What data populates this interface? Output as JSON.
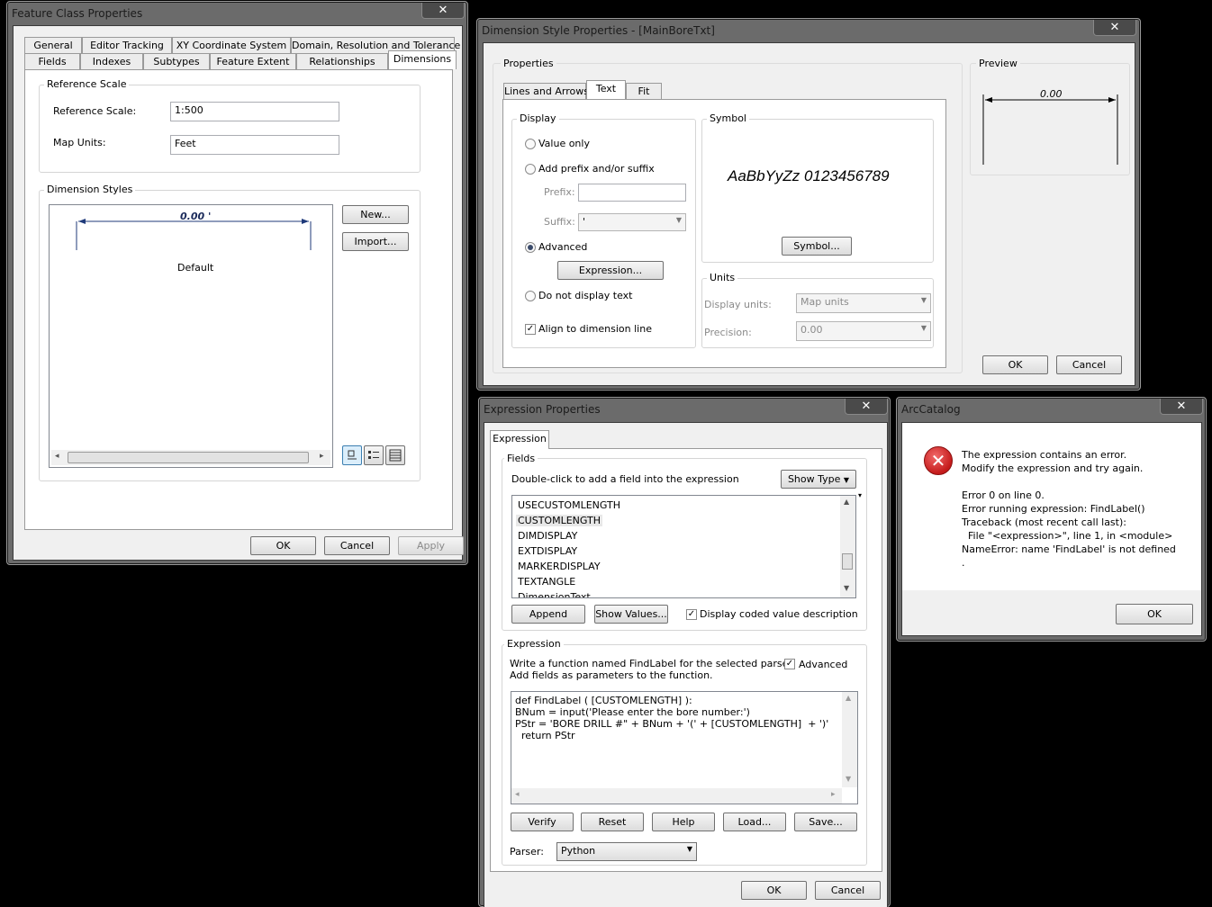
{
  "fc": {
    "title": "Feature Class Properties",
    "tabs_row1": [
      "General",
      "Editor Tracking",
      "XY Coordinate System",
      "Domain, Resolution and Tolerance"
    ],
    "tabs_row2": [
      "Fields",
      "Indexes",
      "Subtypes",
      "Feature Extent",
      "Relationships",
      "Dimensions"
    ],
    "reference_scale_group": "Reference Scale",
    "reference_scale_label": "Reference Scale:",
    "reference_scale_value": "1:500",
    "map_units_label": "Map Units:",
    "map_units_value": "Feet",
    "dimension_styles_group": "Dimension Styles",
    "preview_value": "0.00 '",
    "style_name": "Default",
    "new_button": "New...",
    "import_button": "Import...",
    "ok": "OK",
    "cancel": "Cancel",
    "apply": "Apply"
  },
  "ds": {
    "title": "Dimension Style Properties - [MainBoreTxt]",
    "properties_group": "Properties",
    "preview_group": "Preview",
    "preview_value": "0.00",
    "tabs": [
      "Lines and Arrows",
      "Text",
      "Fit"
    ],
    "display_group": "Display",
    "value_only": "Value only",
    "add_prefix": "Add prefix and/or suffix",
    "prefix_label": "Prefix:",
    "suffix_label": "Suffix:",
    "suffix_value": "'",
    "advanced": "Advanced",
    "expression_button": "Expression...",
    "do_not_display": "Do not display text",
    "align": "Align to dimension line",
    "symbol_group": "Symbol",
    "symbol_sample": "AaBbYyZz 0123456789",
    "symbol_button": "Symbol...",
    "units_group": "Units",
    "display_units_label": "Display units:",
    "display_units_value": "Map units",
    "precision_label": "Precision:",
    "precision_value": "0.00",
    "ok": "OK",
    "cancel": "Cancel"
  },
  "ep": {
    "title": "Expression Properties",
    "tab": "Expression",
    "fields_group": "Fields",
    "fields_hint": "Double-click to add a field into the expression",
    "show_type": "Show Type",
    "fields": [
      "USECUSTOMLENGTH",
      "CUSTOMLENGTH",
      "DIMDISPLAY",
      "EXTDISPLAY",
      "MARKERDISPLAY",
      "TEXTANGLE",
      "DimensionText"
    ],
    "append": "Append",
    "show_values": "Show Values...",
    "coded_value": "Display coded value description",
    "expression_group": "Expression",
    "expr_hint_1": "Write a function named FindLabel for the selected parser.",
    "expr_hint_2": "Add fields as parameters to the function.",
    "advanced": "Advanced",
    "code": [
      "def FindLabel ( [CUSTOMLENGTH] ):",
      "BNum = input('Please enter the bore number:')",
      "PStr = 'BORE DRILL #\" + BNum + '(' + [CUSTOMLENGTH]  + ')'",
      "  return PStr"
    ],
    "verify": "Verify",
    "reset": "Reset",
    "help": "Help",
    "load": "Load...",
    "save": "Save...",
    "parser_label": "Parser:",
    "parser_value": "Python",
    "ok": "OK",
    "cancel": "Cancel"
  },
  "ac": {
    "title": "ArcCatalog",
    "lines": [
      "The expression contains an error.",
      "Modify the expression and try again.",
      "",
      "Error 0 on line 0.",
      "Error running expression: FindLabel()",
      "Traceback (most recent call last):",
      "  File \"<expression>\", line 1, in <module>",
      "NameError: name 'FindLabel' is not defined",
      "."
    ],
    "ok": "OK"
  },
  "close_glyph": "✕",
  "colors": {
    "chrome": "#6b6b6b",
    "client": "#f0f0f0",
    "error_red": "#d32f2f",
    "dimension_line": "#1f3a7a"
  }
}
